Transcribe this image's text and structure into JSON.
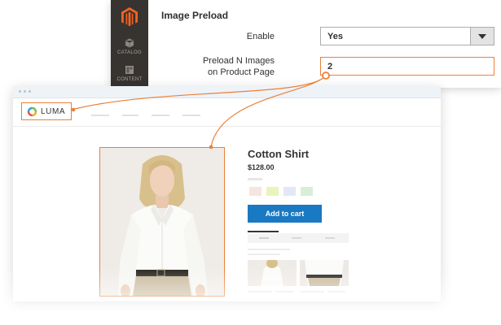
{
  "admin": {
    "sidebar": [
      {
        "label": "CATALOG",
        "icon": "cube-icon"
      },
      {
        "label": "CONTENT",
        "icon": "layout-icon"
      }
    ],
    "section_title": "Image Preload",
    "enable_label": "Enable",
    "enable_value": "Yes",
    "preload_label_line1": "Preload N Images",
    "preload_label_line2": "on Product Page",
    "preload_value": "2"
  },
  "store": {
    "logo_text": "LUMA",
    "product_title": "Cotton Shirt",
    "product_price": "$128.00",
    "swatch_colors": [
      "#f6e5e0",
      "#eaf3bb",
      "#e2e8f5",
      "#d6efd6"
    ],
    "cart_button": "Add to cart"
  },
  "colors": {
    "accent": "#eb8038",
    "button_blue": "#1979c3",
    "admin_sidebar": "#373330",
    "magento_orange": "#f26322"
  }
}
